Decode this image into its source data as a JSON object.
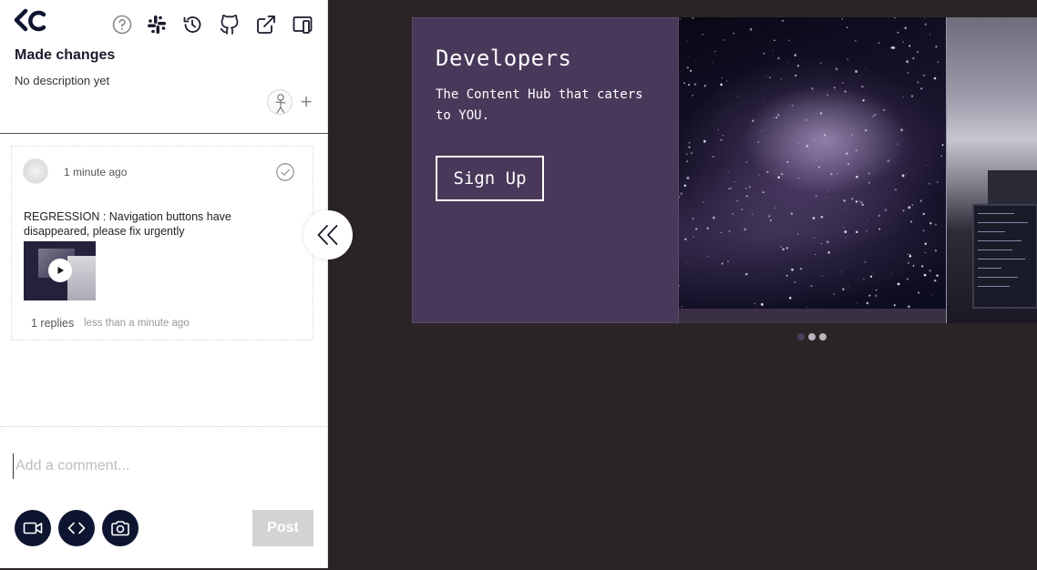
{
  "toolbar": {
    "icons": [
      "help-icon",
      "slack-icon",
      "history-icon",
      "github-icon",
      "external-link-icon",
      "toggle-layout-icon"
    ]
  },
  "issue": {
    "title": "Made changes",
    "description": "No description yet"
  },
  "comment": {
    "time": "1 minute ago",
    "text": "REGRESSION : Navigation buttons have disappeared, please fix urgently",
    "replies": "1 replies",
    "replies_time": "less than a minute ago"
  },
  "composer": {
    "placeholder": "Add a comment...",
    "post_label": "Post"
  },
  "preview": {
    "slide_title": "Developers",
    "slide_subtitle": "The Content Hub that caters to YOU.",
    "signup_label": "Sign Up",
    "dots_count": 3,
    "active_dot": 0
  },
  "colors": {
    "panel_bg": "#ffffff",
    "page_bg": "#2a2427",
    "accent_dark": "#0e1530",
    "slide_bg": "#483859",
    "post_disabled": "#d3d3d3"
  }
}
